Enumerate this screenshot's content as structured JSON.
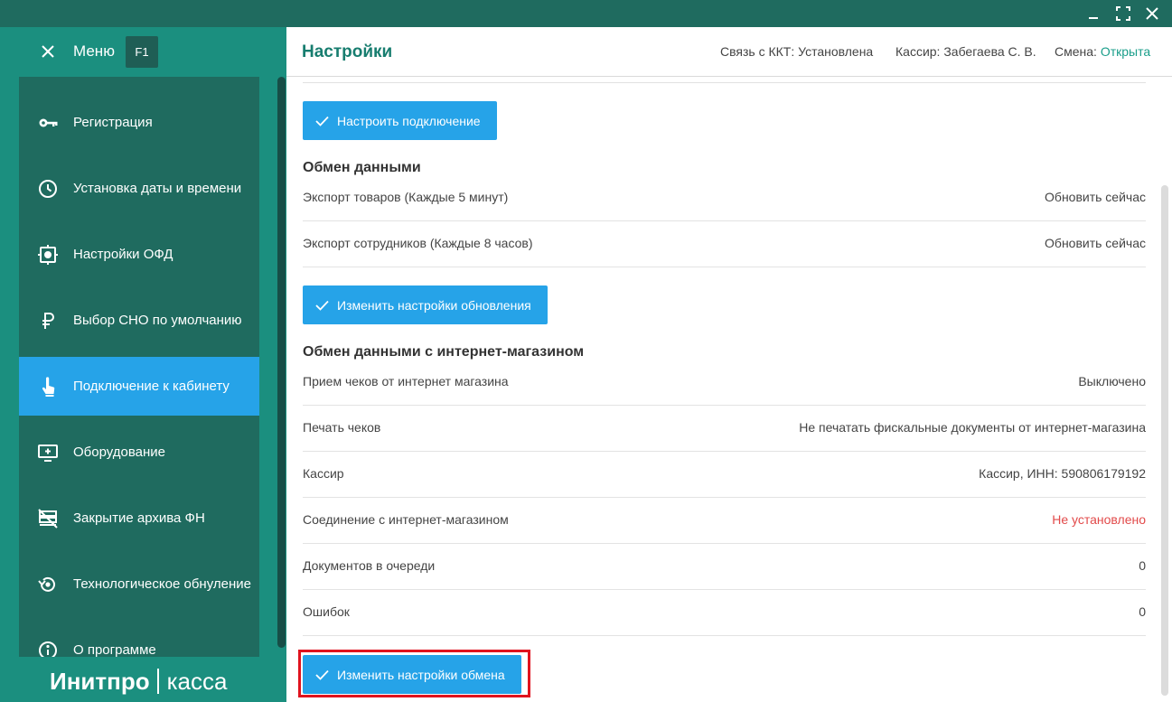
{
  "window": {
    "controls": [
      "minimize-icon",
      "maximize-icon",
      "close-icon"
    ]
  },
  "menu": {
    "title": "Меню",
    "shortcut": "F1"
  },
  "sidebar": {
    "items": [
      {
        "label": "Регистрация",
        "icon": "key-icon",
        "active": false
      },
      {
        "label": "Установка даты и времени",
        "icon": "clock-icon",
        "active": false
      },
      {
        "label": "Настройки ОФД",
        "icon": "ofd-settings-icon",
        "active": false
      },
      {
        "label": "Выбор СНО по умолчанию",
        "icon": "ruble-icon",
        "active": false
      },
      {
        "label": "Подключение к кабинету",
        "icon": "touch-icon",
        "active": true
      },
      {
        "label": "Оборудование",
        "icon": "monitor-add-icon",
        "active": false
      },
      {
        "label": "Закрытие архива ФН",
        "icon": "archive-close-icon",
        "active": false
      },
      {
        "label": "Технологическое обнуление",
        "icon": "reset-icon",
        "active": false
      },
      {
        "label": "О программе",
        "icon": "info-icon",
        "active": false
      }
    ]
  },
  "brand": {
    "part1": "Инитпро",
    "part2": "касса"
  },
  "header": {
    "title": "Настройки",
    "kkt_label": "Связь с ККТ: Установлена",
    "cashier_label": "Кассир: Забегаева С. В.",
    "shift_label": "Смена: ",
    "shift_value": "Открыта"
  },
  "main": {
    "configure_connection_button": "Настроить подключение",
    "data_exchange": {
      "title": "Обмен данными",
      "rows": [
        {
          "label": "Экспорт товаров (Каждые 5 минут)",
          "value": "Обновить сейчас"
        },
        {
          "label": "Экспорт сотрудников (Каждые 8 часов)",
          "value": "Обновить сейчас"
        }
      ],
      "button": "Изменить настройки обновления"
    },
    "online_store": {
      "title": "Обмен данными с интернет-магазином",
      "rows": [
        {
          "label": "Прием чеков от интернет магазина",
          "value": "Выключено"
        },
        {
          "label": "Печать чеков",
          "value": "Не печатать фискальные документы от интернет-магазина"
        },
        {
          "label": "Кассир",
          "value": "Кассир, ИНН: 590806179192"
        },
        {
          "label": "Соединение с интернет-магазином",
          "value": "Не установлено"
        },
        {
          "label": "Документов в очереди",
          "value": "0"
        },
        {
          "label": "Ошибок",
          "value": "0"
        }
      ],
      "button": "Изменить настройки обмена"
    }
  },
  "colors": {
    "accent": "#26a3e8",
    "sidebar": "#1f6b5f",
    "menu_bg": "#1b8f7f",
    "title_green": "#177d6f",
    "error": "#e24a4a",
    "highlight": "#e0131e"
  }
}
